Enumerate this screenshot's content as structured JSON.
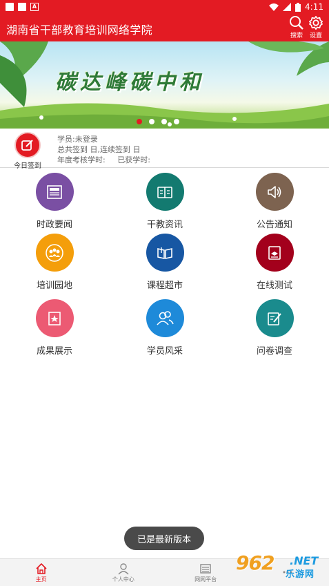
{
  "status_bar": {
    "time": "4:11"
  },
  "app_bar": {
    "title": "湖南省干部教育培训网络学院",
    "search_label": "搜索",
    "settings_label": "设置"
  },
  "banner": {
    "headline": "碳达峰碳中和",
    "dots": 4,
    "active_dot": 0
  },
  "user": {
    "checkin_label": "今日签到",
    "line1": "学员:未登录",
    "line2": "总共签到 日,连续签到 日",
    "line3": "年度考核学时:     已获学时:"
  },
  "grid": [
    {
      "label": "时政要闻",
      "icon": "news-icon",
      "color": "#7a4fa3"
    },
    {
      "label": "干教资讯",
      "icon": "book-open-icon",
      "color": "#137a70"
    },
    {
      "label": "公告通知",
      "icon": "speaker-icon",
      "color": "#7d6350"
    },
    {
      "label": "培训园地",
      "icon": "group-icon",
      "color": "#f49e0b"
    },
    {
      "label": "课程超市",
      "icon": "books-icon",
      "color": "#1757a3"
    },
    {
      "label": "在线测试",
      "icon": "exam-icon",
      "color": "#a3001c"
    },
    {
      "label": "成果展示",
      "icon": "star-icon",
      "color": "#ec5a73"
    },
    {
      "label": "学员风采",
      "icon": "users-icon",
      "color": "#1e8ad9"
    },
    {
      "label": "问卷调查",
      "icon": "survey-icon",
      "color": "#1a8b8d"
    }
  ],
  "toast": "已是最新版本",
  "bottom_nav": [
    {
      "label": "主页",
      "icon": "home-icon",
      "active": true
    },
    {
      "label": "个人中心",
      "icon": "person-icon",
      "active": false
    },
    {
      "label": "网网平台",
      "icon": "list-icon",
      "active": false
    },
    {
      "label": "",
      "icon": "more-icon",
      "active": false
    }
  ],
  "watermark": {
    "big": "962",
    "net": ".NET",
    "sub": "乐游网"
  },
  "colors": {
    "brand": "#e31b23"
  }
}
